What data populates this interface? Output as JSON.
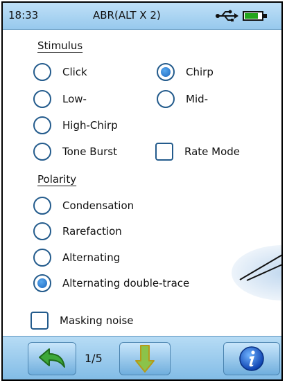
{
  "status": {
    "time": "18:33",
    "title": "ABR(ALT X 2)"
  },
  "stimulus": {
    "label": "Stimulus",
    "options": [
      {
        "label": "Click",
        "selected": false
      },
      {
        "label": "Chirp",
        "selected": true
      },
      {
        "label": "Low-",
        "selected": false
      },
      {
        "label": "Mid-",
        "selected": false
      },
      {
        "label": "High-Chirp",
        "selected": false
      },
      {
        "label": "Tone Burst",
        "selected": false
      }
    ],
    "rate_mode": {
      "label": "Rate Mode",
      "checked": false
    }
  },
  "polarity": {
    "label": "Polarity",
    "options": [
      {
        "label": "Condensation",
        "selected": false
      },
      {
        "label": "Rarefaction",
        "selected": false
      },
      {
        "label": "Alternating",
        "selected": false
      },
      {
        "label": "Alternating double-trace",
        "selected": true
      }
    ]
  },
  "masking": {
    "label": "Masking noise",
    "checked": false
  },
  "toolbar": {
    "page": "1/5"
  },
  "colors": {
    "accent": "#1c68c0",
    "bar": "#97c9ed",
    "battery": "#23a51d"
  },
  "icons": {
    "back": "back-arrow-icon",
    "next": "down-arrow-icon",
    "info": "info-icon",
    "usb": "usb-icon",
    "battery": "battery-icon"
  },
  "battery_level": 0.8
}
